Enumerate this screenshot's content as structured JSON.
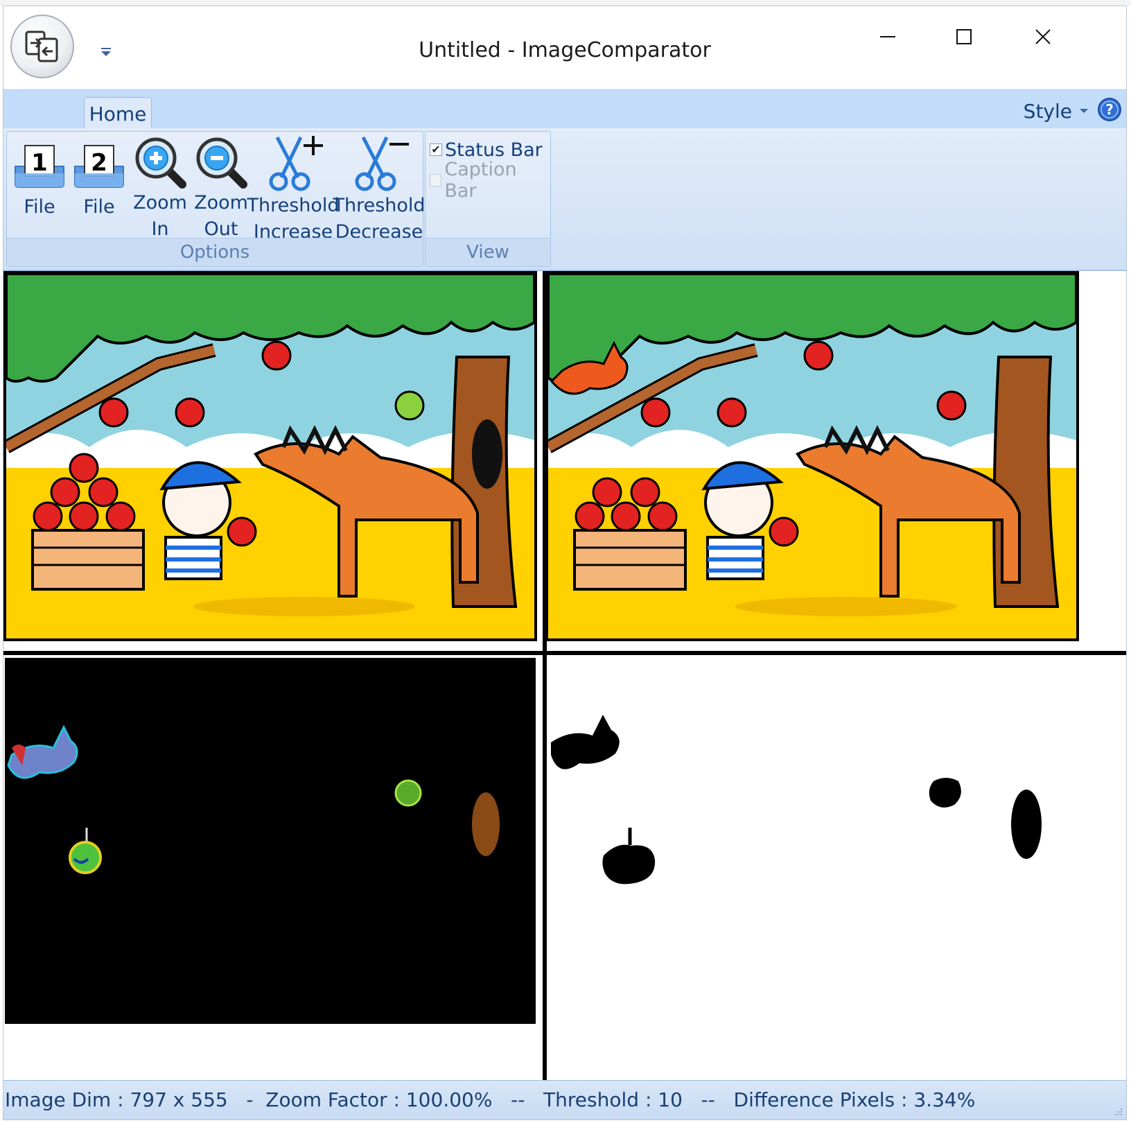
{
  "window": {
    "title": "Untitled - ImageComparator",
    "app_icon": "image-compare-icon",
    "controls": [
      "minimize-icon",
      "maximize-icon",
      "close-icon"
    ]
  },
  "ribbon": {
    "tabs": [
      {
        "label": "Home",
        "active": true
      }
    ],
    "style_menu": "Style",
    "groups": {
      "options": {
        "label": "Options",
        "buttons": [
          {
            "icon": "file1-icon",
            "badge": "1",
            "line1": "File",
            "line2": ""
          },
          {
            "icon": "file2-icon",
            "badge": "2",
            "line1": "File",
            "line2": ""
          },
          {
            "icon": "zoom-in-icon",
            "line1": "Zoom",
            "line2": "In"
          },
          {
            "icon": "zoom-out-icon",
            "line1": "Zoom",
            "line2": "Out"
          },
          {
            "icon": "threshold-increase-icon",
            "line1": "Threshold",
            "line2": "Increase"
          },
          {
            "icon": "threshold-decrease-icon",
            "line1": "Threshold",
            "line2": "Decrease"
          }
        ]
      },
      "view": {
        "label": "View",
        "checks": [
          {
            "label": "Status Bar",
            "checked": true,
            "enabled": true
          },
          {
            "label": "Caption Bar",
            "checked": false,
            "enabled": false
          }
        ]
      }
    }
  },
  "panes": {
    "image1": "apple-tree-scene-original",
    "image2": "apple-tree-scene-modified",
    "diff_color": "difference-color-map",
    "diff_mask": "difference-binary-mask"
  },
  "status": {
    "text": "Image Dim : 797 x 555   -  Zoom Factor : 100.00%   --   Threshold : 10   --   Difference Pixels : 3.34%"
  },
  "colors": {
    "ribbon": "#c2dcf9",
    "accent_text": "#14407a",
    "group_label": "#5a7fb0"
  }
}
